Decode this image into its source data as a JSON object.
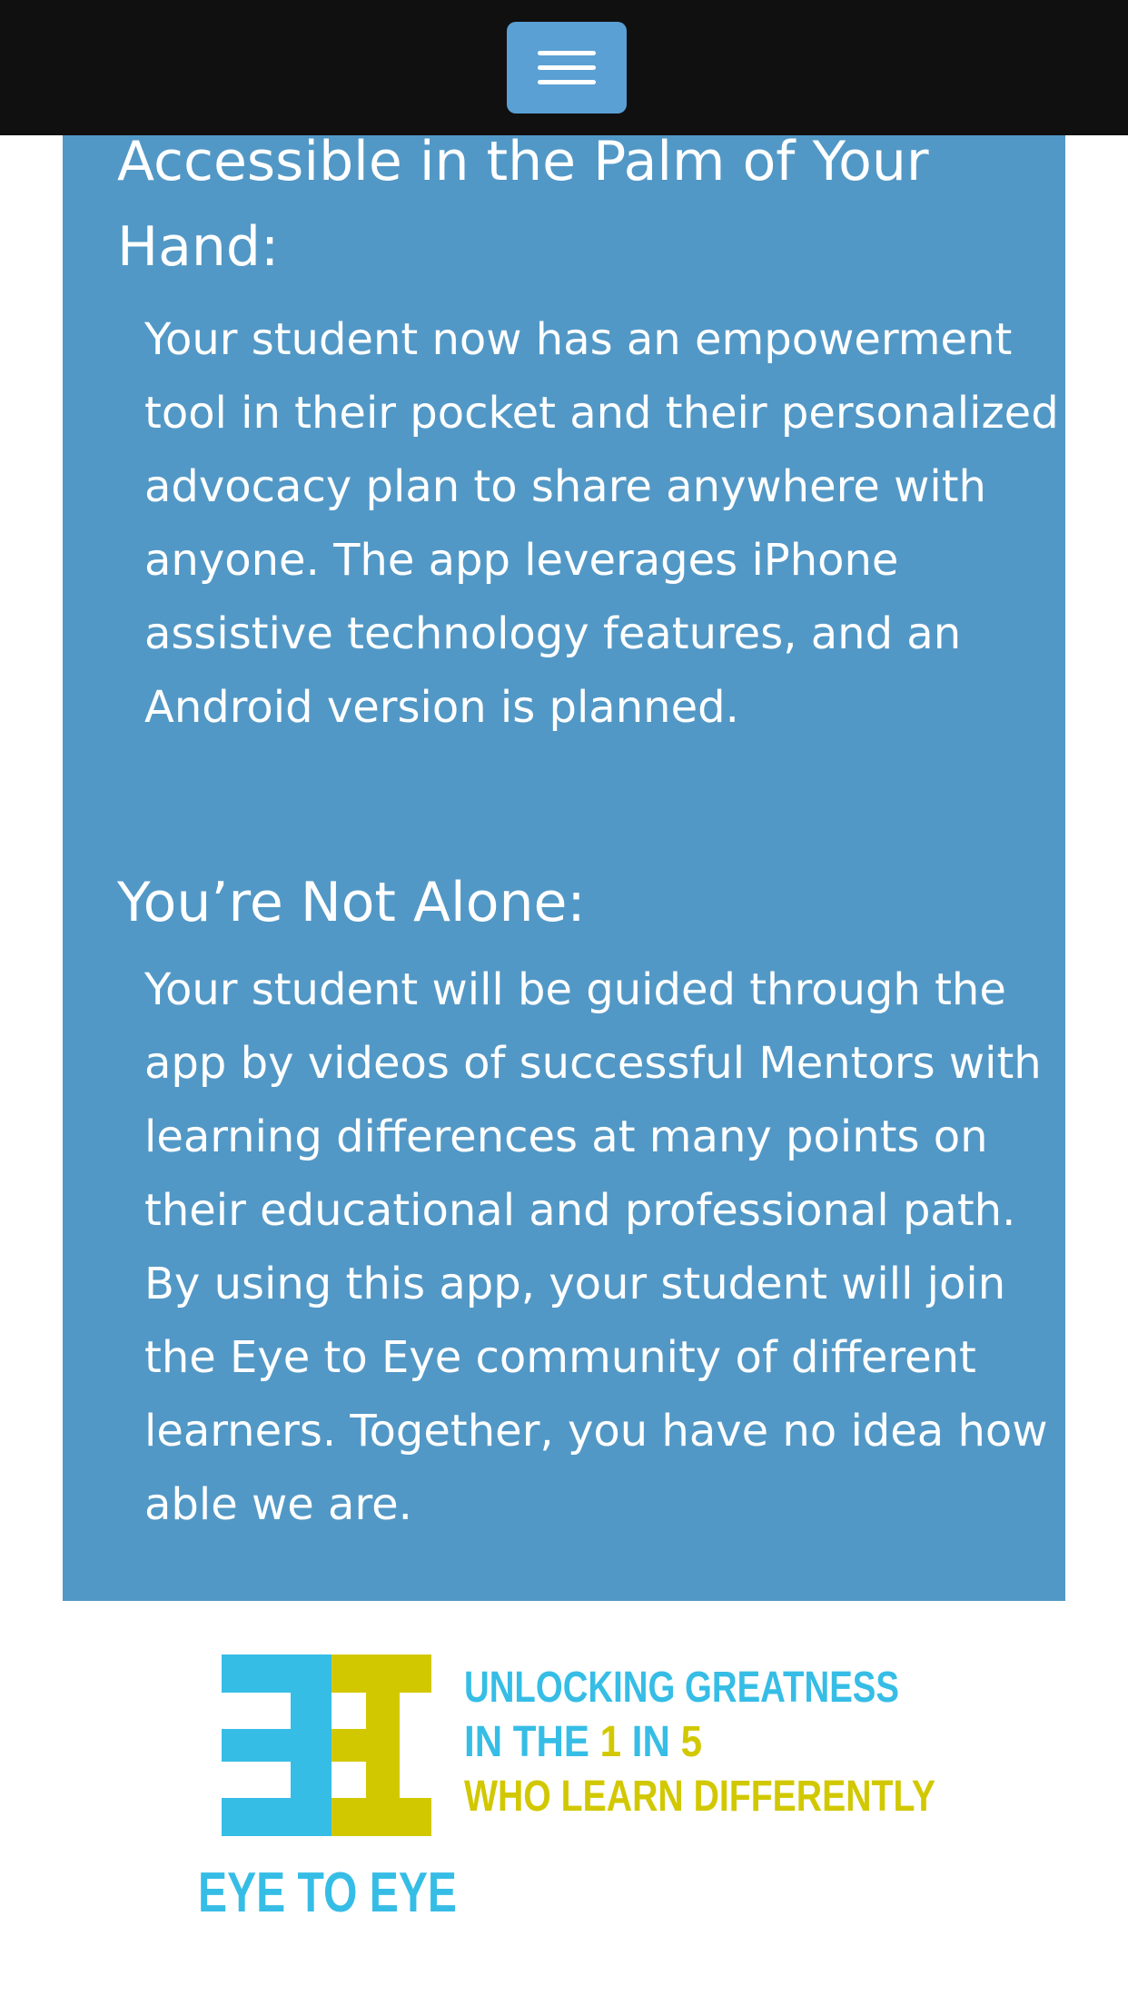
{
  "navbar": {
    "menu_button_icon": "hamburger-menu-icon",
    "menu_button_color": "#5aa0d4"
  },
  "sections": [
    {
      "heading": "Accessible in the Palm of Your Hand:",
      "body": "Your student now has an empowerment tool in their pocket and their personalized advocacy plan to share anywhere with anyone. The app leverages iPhone assistive technology features, and an Android version is planned."
    },
    {
      "heading": "You’re Not Alone:",
      "body": "Your student will be guided through the app by videos of successful Mentors with learning differences at many points on their educational and professional path. By using this app, your student will join the Eye to Eye community of different learners. Together, you have no idea how able we are."
    }
  ],
  "logo": {
    "tagline_line1": "UNLOCKING GREATNESS",
    "tagline_line2_prefix": "IN THE ",
    "tagline_line2_num1": "1",
    "tagline_line2_mid": " IN ",
    "tagline_line2_num2": "5",
    "tagline_line3": "WHO LEARN DIFFERENTLY",
    "brand_name": "EYE TO EYE",
    "colors": {
      "blue": "#36bde6",
      "yellow": "#d2c800",
      "panel": "#5298c6"
    }
  }
}
